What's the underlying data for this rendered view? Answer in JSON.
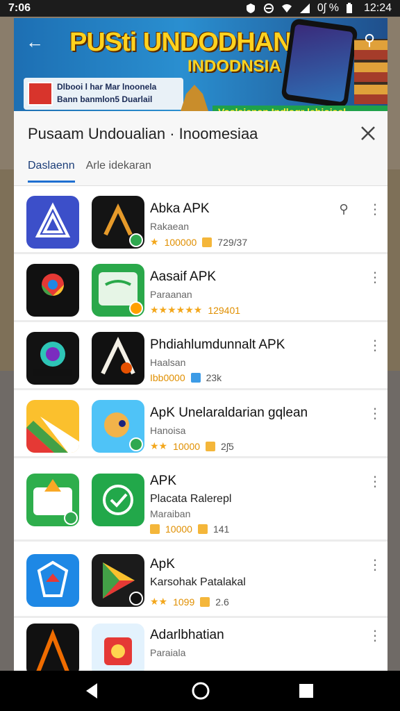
{
  "status_bar": {
    "left_time": "7:06",
    "right_text": "12:24",
    "battery_text": "0ʃ %"
  },
  "banner": {
    "title": "PUSti UNDODHAN",
    "subtitle": "INDODNSIA",
    "left_line1": "Dlbooi l har Mar lnoonela",
    "left_line2": "Bann banmlon5 Duarlail",
    "strip_text": "Voslaienan Indlogr lehioiael"
  },
  "sheet": {
    "title": "Pusaam Undoualian · Inoomesiaa",
    "tabs": [
      {
        "label": "Daslaenn",
        "active": true
      },
      {
        "label": "Arle idekaran",
        "active": false
      }
    ]
  },
  "apps": [
    {
      "name": "Abka APK",
      "sub": "Rakaean",
      "rating": "100000",
      "downloads": "729/37",
      "stars": "★",
      "has_pin": true
    },
    {
      "name": "Aasaif APK",
      "sub": "Paraanan",
      "rating": "129401",
      "downloads": "",
      "stars": "★★★★★★",
      "has_pin": false
    },
    {
      "name": "Phdiahlumdunnalt APK",
      "sub": "Haalsan",
      "rating": "Ibb0000",
      "downloads": "23k",
      "stars": "",
      "has_pin": false
    },
    {
      "name": "ApK Unelaraldarian gqlean",
      "sub": "Hanoisa",
      "rating": "10000",
      "downloads": "2ʃ5",
      "stars": "★★",
      "has_pin": false
    },
    {
      "name": "APK",
      "sub": "Placata Ralerepl",
      "sub2": "Maraiban",
      "rating": "10000",
      "downloads": "141",
      "stars": "",
      "has_pin": false
    },
    {
      "name": "ApK",
      "sub": "Karsohak Patalakal",
      "rating": "1099",
      "downloads": "2.6",
      "stars": "★★",
      "has_pin": false
    },
    {
      "name": "Adarlbhatian",
      "sub": "Paraiala",
      "rating": "",
      "downloads": "",
      "stars": "",
      "has_pin": false
    }
  ]
}
